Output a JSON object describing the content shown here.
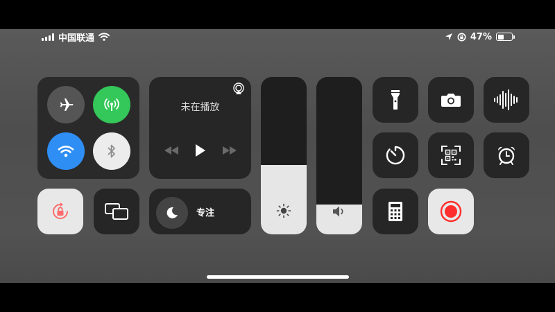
{
  "status_bar": {
    "carrier": "中国联通",
    "battery": "47%",
    "battery_level": 0.47,
    "signal_bars": 4
  },
  "media": {
    "title": "未在播放"
  },
  "focus": {
    "label": "专注"
  },
  "sliders": {
    "brightness_level": 0.44,
    "volume_level": 0.19
  },
  "colors": {
    "cellular_green": "#34c759",
    "wifi_blue": "#2f8ef4",
    "record_red": "#ff2d2d",
    "lock_red": "#ff6b6b"
  },
  "icons": {
    "airplane": "airplane-icon",
    "cellular": "antenna-icon",
    "wifi": "wifi-icon",
    "bluetooth": "bluetooth-icon",
    "airplay": "airplay-icon",
    "flashlight": "flashlight-icon",
    "camera": "camera-icon",
    "voice_memo": "waveform-icon",
    "timer": "timer-icon",
    "qr_scanner": "qr-code-icon",
    "alarm": "alarm-clock-icon",
    "calculator": "calculator-icon",
    "screen_record": "record-icon",
    "rotation_lock": "rotation-lock-icon",
    "screen_mirroring": "screen-mirroring-icon",
    "moon": "moon-icon",
    "sun": "sun-icon",
    "speaker": "speaker-icon"
  }
}
